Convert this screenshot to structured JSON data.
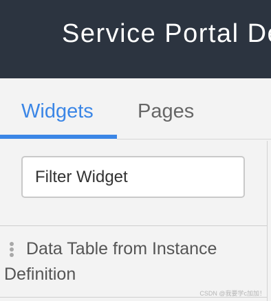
{
  "header": {
    "title": "Service Portal Designer"
  },
  "tabs": [
    {
      "label": "Widgets",
      "active": true
    },
    {
      "label": "Pages",
      "active": false
    }
  ],
  "filter": {
    "placeholder": "Filter Widget",
    "value": ""
  },
  "widgets": [
    {
      "label": "Data Table from Instance Definition"
    }
  ],
  "watermark": "CSDN @我要学c加加！",
  "colors": {
    "header_bg": "#2c3440",
    "accent": "#3b86e6",
    "panel_bg": "#f3f3f3"
  },
  "icons": {
    "drag_handle": "drag-handle-icon"
  }
}
